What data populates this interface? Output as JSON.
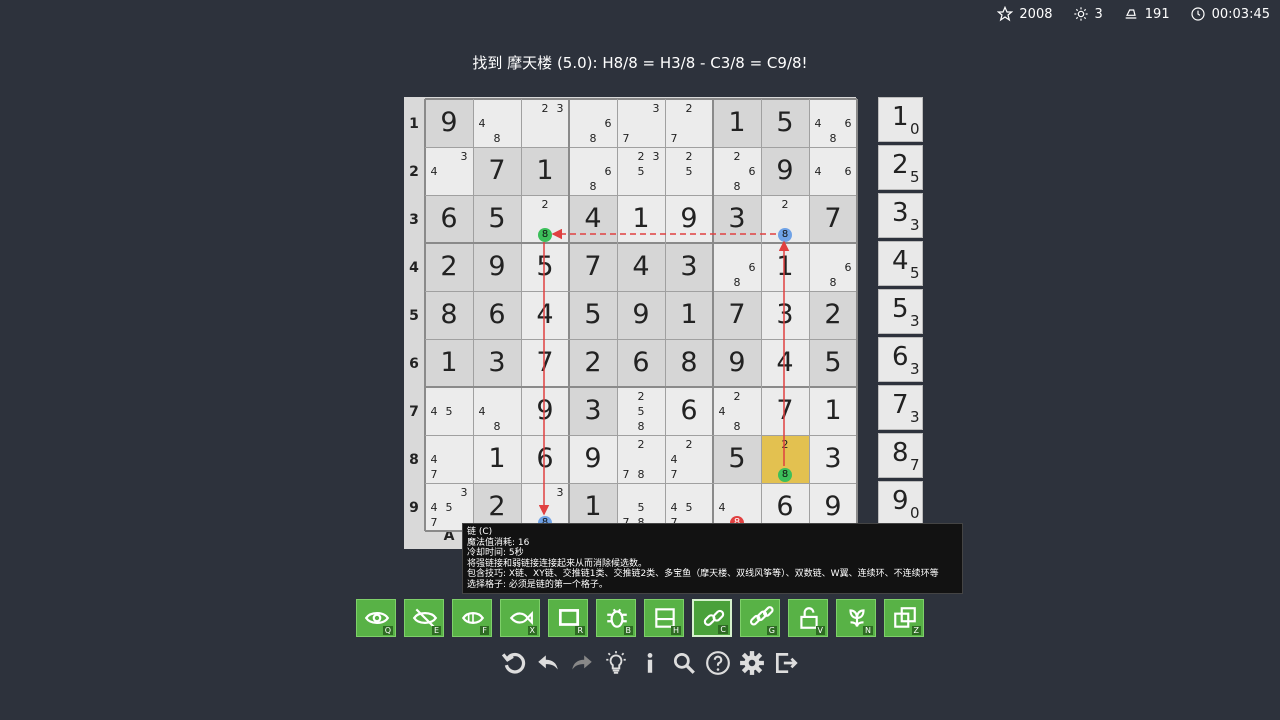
{
  "stats": {
    "stars": "2008",
    "hints": "3",
    "moves": "191",
    "time": "00:03:45"
  },
  "hint_message": "找到 摩天楼 (5.0): H8/8 = H3/8 - C3/8 = C9/8!",
  "row_labels": [
    "1",
    "2",
    "3",
    "4",
    "5",
    "6",
    "7",
    "8",
    "9"
  ],
  "col_labels": [
    "A"
  ],
  "grid": [
    [
      {
        "v": "9",
        "g": true
      },
      {
        "c": [
          "4",
          "8"
        ]
      },
      {
        "c": [
          "2",
          "3"
        ]
      },
      {
        "c": [
          "6",
          "8"
        ]
      },
      {
        "c": [
          "3",
          "7"
        ]
      },
      {
        "c": [
          "2",
          "7"
        ]
      },
      {
        "v": "1",
        "g": true
      },
      {
        "v": "5",
        "g": true
      },
      {
        "c": [
          "4",
          "6",
          "8"
        ]
      }
    ],
    [
      {
        "c": [
          "3",
          "4"
        ]
      },
      {
        "v": "7",
        "g": true
      },
      {
        "v": "1",
        "g": true
      },
      {
        "c": [
          "6",
          "8"
        ]
      },
      {
        "c": [
          "2",
          "3",
          "5"
        ]
      },
      {
        "c": [
          "2",
          "5"
        ]
      },
      {
        "c": [
          "2",
          "6",
          "8"
        ]
      },
      {
        "v": "9",
        "g": true
      },
      {
        "c": [
          "4",
          "6"
        ]
      }
    ],
    [
      {
        "v": "6",
        "g": true
      },
      {
        "v": "5",
        "g": true
      },
      {
        "c": [
          "2",
          "8"
        ],
        "m": "8",
        "mc": "green"
      },
      {
        "v": "4",
        "g": true
      },
      {
        "v": "1"
      },
      {
        "v": "9"
      },
      {
        "v": "3",
        "g": true
      },
      {
        "c": [
          "2",
          "8"
        ],
        "m": "8",
        "mc": "blue"
      },
      {
        "v": "7",
        "g": true
      }
    ],
    [
      {
        "v": "2",
        "g": true
      },
      {
        "v": "9",
        "g": true
      },
      {
        "v": "5"
      },
      {
        "v": "7",
        "g": true
      },
      {
        "v": "4",
        "g": true
      },
      {
        "v": "3",
        "g": true
      },
      {
        "c": [
          "6",
          "8"
        ]
      },
      {
        "v": "1"
      },
      {
        "c": [
          "6",
          "8"
        ]
      }
    ],
    [
      {
        "v": "8",
        "g": true
      },
      {
        "v": "6",
        "g": true
      },
      {
        "v": "4"
      },
      {
        "v": "5",
        "g": true
      },
      {
        "v": "9",
        "g": true
      },
      {
        "v": "1",
        "g": true
      },
      {
        "v": "7",
        "g": true
      },
      {
        "v": "3"
      },
      {
        "v": "2",
        "g": true
      }
    ],
    [
      {
        "v": "1",
        "g": true
      },
      {
        "v": "3",
        "g": true
      },
      {
        "v": "7"
      },
      {
        "v": "2",
        "g": true
      },
      {
        "v": "6",
        "g": true
      },
      {
        "v": "8",
        "g": true
      },
      {
        "v": "9",
        "g": true
      },
      {
        "v": "4"
      },
      {
        "v": "5",
        "g": true
      }
    ],
    [
      {
        "c": [
          "4",
          "5"
        ]
      },
      {
        "c": [
          "4",
          "8"
        ]
      },
      {
        "v": "9"
      },
      {
        "v": "3",
        "g": true
      },
      {
        "c": [
          "2",
          "5",
          "8"
        ]
      },
      {
        "v": "6"
      },
      {
        "c": [
          "2",
          "4",
          "8"
        ]
      },
      {
        "v": "7"
      },
      {
        "v": "1"
      }
    ],
    [
      {
        "c": [
          "4",
          "7"
        ]
      },
      {
        "v": "1"
      },
      {
        "v": "6"
      },
      {
        "v": "9"
      },
      {
        "c": [
          "2",
          "7",
          "8"
        ]
      },
      {
        "c": [
          "2",
          "4",
          "7"
        ]
      },
      {
        "v": "5",
        "g": true
      },
      {
        "c": [
          "2",
          "8"
        ],
        "m": "8",
        "mc": "green",
        "hl": true
      },
      {
        "v": "3"
      }
    ],
    [
      {
        "c": [
          "3",
          "4",
          "5",
          "7"
        ]
      },
      {
        "v": "2",
        "g": true
      },
      {
        "c": [
          "3",
          "8"
        ],
        "m": "8",
        "mc": "blue"
      },
      {
        "v": "1",
        "g": true
      },
      {
        "c": [
          "5",
          "7",
          "8"
        ]
      },
      {
        "c": [
          "4",
          "5",
          "7"
        ]
      },
      {
        "c": [
          "4",
          "8"
        ],
        "m": "8",
        "mc": "red"
      },
      {
        "v": "6"
      },
      {
        "v": "9"
      }
    ]
  ],
  "side_counts": [
    {
      "n": "1",
      "c": "0"
    },
    {
      "n": "2",
      "c": "5"
    },
    {
      "n": "3",
      "c": "3"
    },
    {
      "n": "4",
      "c": "5"
    },
    {
      "n": "5",
      "c": "3"
    },
    {
      "n": "6",
      "c": "3"
    },
    {
      "n": "7",
      "c": "3"
    },
    {
      "n": "8",
      "c": "7"
    },
    {
      "n": "9",
      "c": "0"
    }
  ],
  "tooltip": {
    "line1": "链 (C)",
    "line2": "魔法值消耗: 16",
    "line3": "冷却时间: 5秒",
    "line4": "将强链接和弱链接连接起来从而消除候选数。",
    "line5": "包含技巧: X链、XY链、交推链1类、交推链2类、多宝鱼（摩天楼、双线风筝等）、双数链、W翼、连续环、不连续环等",
    "line6": "选择格子: 必须是链的第一个格子。"
  },
  "tools": [
    {
      "key": "Q",
      "icon": "eye-icon"
    },
    {
      "key": "E",
      "icon": "eye-slash-icon"
    },
    {
      "key": "F",
      "icon": "fish-eye-icon"
    },
    {
      "key": "X",
      "icon": "fish-icon"
    },
    {
      "key": "R",
      "icon": "rectangle-icon"
    },
    {
      "key": "B",
      "icon": "bug-icon"
    },
    {
      "key": "H",
      "icon": "split-box-icon"
    },
    {
      "key": "C",
      "icon": "chain-icon"
    },
    {
      "key": "G",
      "icon": "double-chain-icon"
    },
    {
      "key": "V",
      "icon": "unlock-icon"
    },
    {
      "key": "N",
      "icon": "flower-icon"
    },
    {
      "key": "Z",
      "icon": "copy-icon"
    }
  ],
  "colors": {
    "bg": "#2d323c",
    "green": "#58b246",
    "highlight": "#e3c150",
    "red_chain": "#e04040"
  }
}
